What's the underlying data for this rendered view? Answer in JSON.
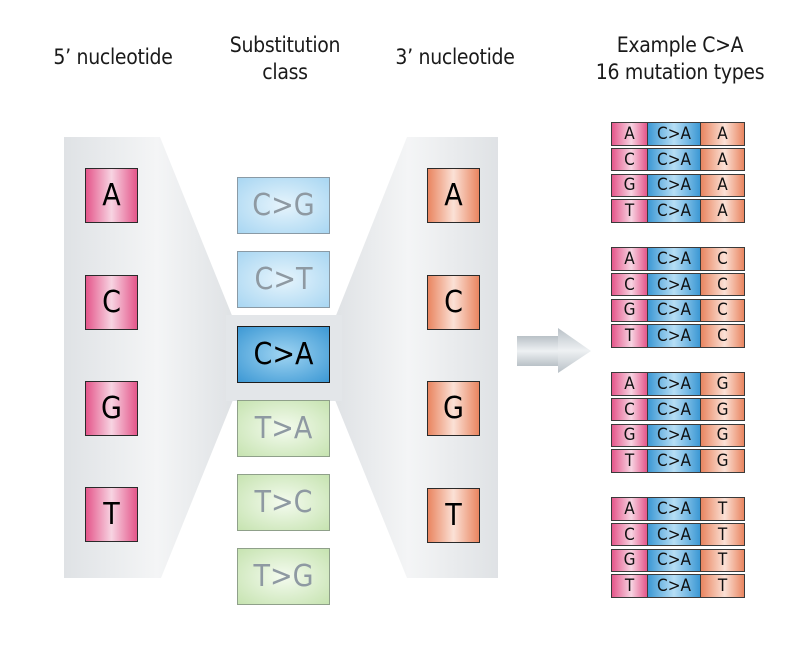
{
  "headings": {
    "five_prime": [
      "5’ nucleotide"
    ],
    "substitution": [
      "Substitution",
      "class"
    ],
    "three_prime": [
      "3’ nucleotide"
    ],
    "example": [
      "Example C>A",
      "16 mutation types"
    ]
  },
  "five_prime_nucleotides": [
    "A",
    "C",
    "G",
    "T"
  ],
  "substitution_classes": [
    {
      "label": "C>G",
      "family": "C",
      "selected": false
    },
    {
      "label": "C>T",
      "family": "C",
      "selected": false
    },
    {
      "label": "C>A",
      "family": "C",
      "selected": true
    },
    {
      "label": "T>A",
      "family": "T",
      "selected": false
    },
    {
      "label": "T>C",
      "family": "T",
      "selected": false
    },
    {
      "label": "T>G",
      "family": "T",
      "selected": false
    }
  ],
  "three_prime_nucleotides": [
    "A",
    "C",
    "G",
    "T"
  ],
  "arrow_icon": "right-arrow",
  "mutation_types": [
    {
      "three_prime": "A",
      "rows": [
        [
          "A",
          "C>A",
          "A"
        ],
        [
          "C",
          "C>A",
          "A"
        ],
        [
          "G",
          "C>A",
          "A"
        ],
        [
          "T",
          "C>A",
          "A"
        ]
      ]
    },
    {
      "three_prime": "C",
      "rows": [
        [
          "A",
          "C>A",
          "C"
        ],
        [
          "C",
          "C>A",
          "C"
        ],
        [
          "G",
          "C>A",
          "C"
        ],
        [
          "T",
          "C>A",
          "C"
        ]
      ]
    },
    {
      "three_prime": "G",
      "rows": [
        [
          "A",
          "C>A",
          "G"
        ],
        [
          "C",
          "C>A",
          "G"
        ],
        [
          "G",
          "C>A",
          "G"
        ],
        [
          "T",
          "C>A",
          "G"
        ]
      ]
    },
    {
      "three_prime": "T",
      "rows": [
        [
          "A",
          "C>A",
          "T"
        ],
        [
          "C",
          "C>A",
          "T"
        ],
        [
          "G",
          "C>A",
          "T"
        ],
        [
          "T",
          "C>A",
          "T"
        ]
      ]
    }
  ],
  "colors": {
    "five_prime": "#e4568a",
    "three_prime": "#e98560",
    "c_class": "#a8d6f2",
    "t_class": "#c6e3b0",
    "selected_class": "#3c98d4",
    "funnel": "#e3e6e9"
  }
}
